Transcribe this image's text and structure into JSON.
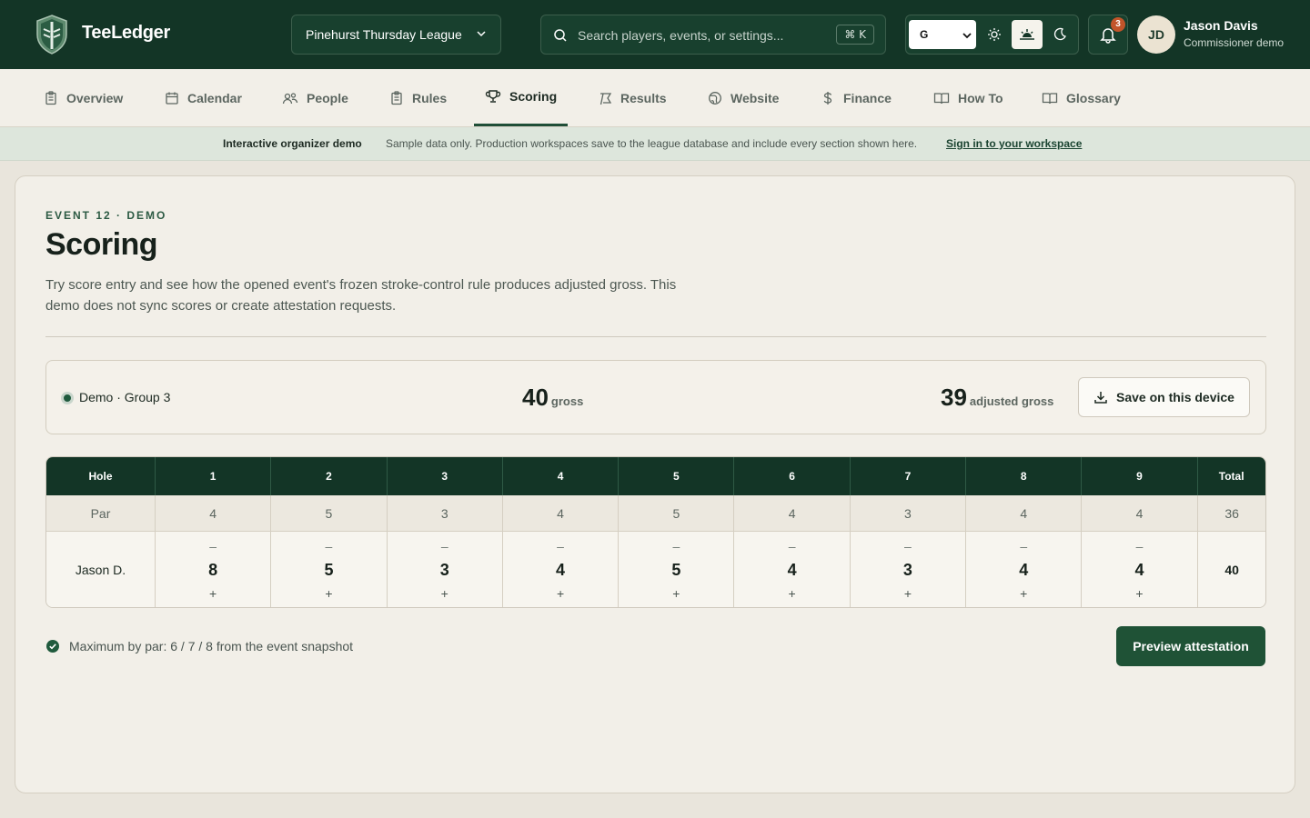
{
  "app": {
    "brand": "TeeLedger"
  },
  "header": {
    "league": "Pinehurst Thursday League",
    "search_placeholder": "Search players, events, or settings...",
    "shortcut": "⌘ K",
    "font_select": "G",
    "notifications": "3",
    "user": {
      "initials": "JD",
      "name": "Jason Davis",
      "role": "Commissioner demo"
    }
  },
  "nav": {
    "items": [
      {
        "label": "Overview",
        "icon": "clipboard-icon"
      },
      {
        "label": "Calendar",
        "icon": "calendar-icon"
      },
      {
        "label": "People",
        "icon": "people-icon"
      },
      {
        "label": "Rules",
        "icon": "clipboard-icon"
      },
      {
        "label": "Scoring",
        "icon": "trophy-icon",
        "active": true
      },
      {
        "label": "Results",
        "icon": "flag-icon"
      },
      {
        "label": "Website",
        "icon": "globe-icon"
      },
      {
        "label": "Finance",
        "icon": "dollar-icon"
      },
      {
        "label": "How To",
        "icon": "book-icon"
      },
      {
        "label": "Glossary",
        "icon": "book-icon"
      }
    ]
  },
  "banner": {
    "title": "Interactive organizer demo",
    "text": "Sample data only. Production workspaces save to the league database and include every section shown here.",
    "link": "Sign in to your workspace"
  },
  "page": {
    "eyebrow": "EVENT 12 · DEMO",
    "title": "Scoring",
    "description": "Try score entry and see how the opened event's frozen stroke-control rule produces adjusted gross. This demo does not sync scores or create attestation requests."
  },
  "summary": {
    "group": "Demo · Group 3",
    "gross_value": "40",
    "gross_label": "gross",
    "adjusted_value": "39",
    "adjusted_label": "adjusted gross",
    "save_label": "Save on this device"
  },
  "scorecard": {
    "hole_label": "Hole",
    "holes": [
      "1",
      "2",
      "3",
      "4",
      "5",
      "6",
      "7",
      "8",
      "9"
    ],
    "total_label": "Total",
    "par_label": "Par",
    "par": [
      "4",
      "5",
      "3",
      "4",
      "5",
      "4",
      "3",
      "4",
      "4"
    ],
    "par_total": "36",
    "player": "Jason D.",
    "scores": [
      "8",
      "5",
      "3",
      "4",
      "5",
      "4",
      "3",
      "4",
      "4"
    ],
    "player_total": "40",
    "minus": "–",
    "plus": "+"
  },
  "footer": {
    "rule_note": "Maximum by par: 6 / 7 / 8 from the event snapshot",
    "preview_label": "Preview attestation"
  },
  "colors": {
    "primary": "#133526",
    "accent": "#1f5236",
    "badge": "#c2542a",
    "background": "#e9e5dc"
  }
}
